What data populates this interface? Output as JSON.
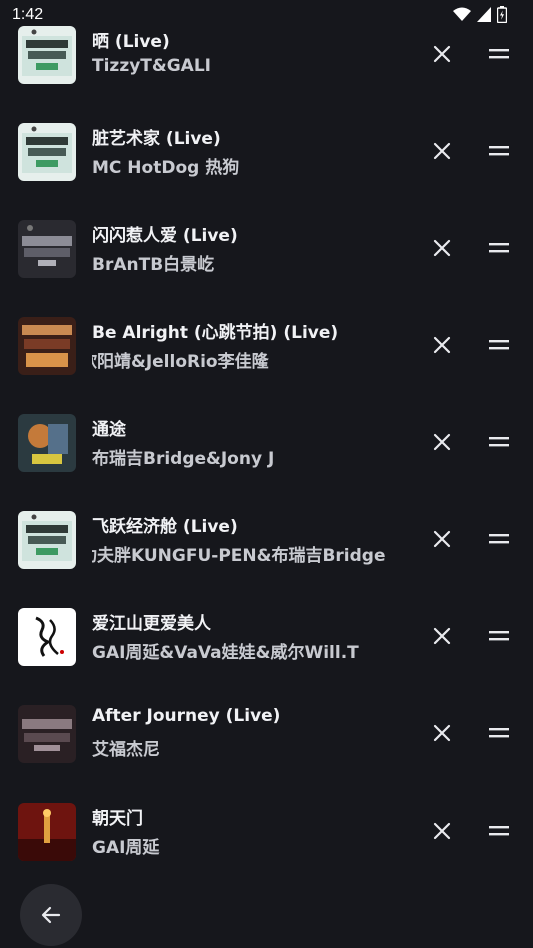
{
  "status_bar": {
    "time": "1:42",
    "icons": [
      "wifi-icon",
      "cellular-signal-icon",
      "battery-icon"
    ]
  },
  "playlist": {
    "tracks": [
      {
        "title": "晒 (Live)",
        "artist": "TizzyT&GALI",
        "cover": "rap-of-china-green-cover"
      },
      {
        "title": "脏艺术家 (Live)",
        "artist": "MC HotDog 热狗",
        "cover": "rap-of-china-green-cover"
      },
      {
        "title": "闪闪惹人爱 (Live)",
        "artist": "BrAnTB白景屹",
        "cover": "rap-of-china-dark-cover"
      },
      {
        "title": "Be Alright (心跳节拍) (Live)",
        "artist": "欧阳靖&JelloRio李佳隆",
        "cover": "rap-of-china-red-cover"
      },
      {
        "title": "通途",
        "artist": "布瑞吉Bridge&Jony J",
        "cover": "illustrated-cover"
      },
      {
        "title": "飞跃经济舱 (Live)",
        "artist": "功夫胖KUNGFU-PEN&布瑞吉Bridge",
        "cover": "rap-of-china-green-cover"
      },
      {
        "title": "爱江山更爱美人",
        "artist": "GAI周延&VaVa娃娃&威尔Will.T",
        "cover": "calligraphy-cover"
      },
      {
        "title": "After Journey (Live)",
        "artist": "艾福杰尼",
        "cover": "rap-of-china-dark-cover"
      },
      {
        "title": "朝天门",
        "artist": "GAI周延",
        "cover": "red-city-cover"
      }
    ]
  },
  "actions": {
    "remove_icon": "close-icon",
    "drag_icon": "drag-handle-icon",
    "back_icon": "back-arrow-icon"
  },
  "colors": {
    "background": "#16171c",
    "title_text": "#f1f2f5",
    "artist_text": "#c8cad0",
    "back_button": "#2a2b31"
  }
}
